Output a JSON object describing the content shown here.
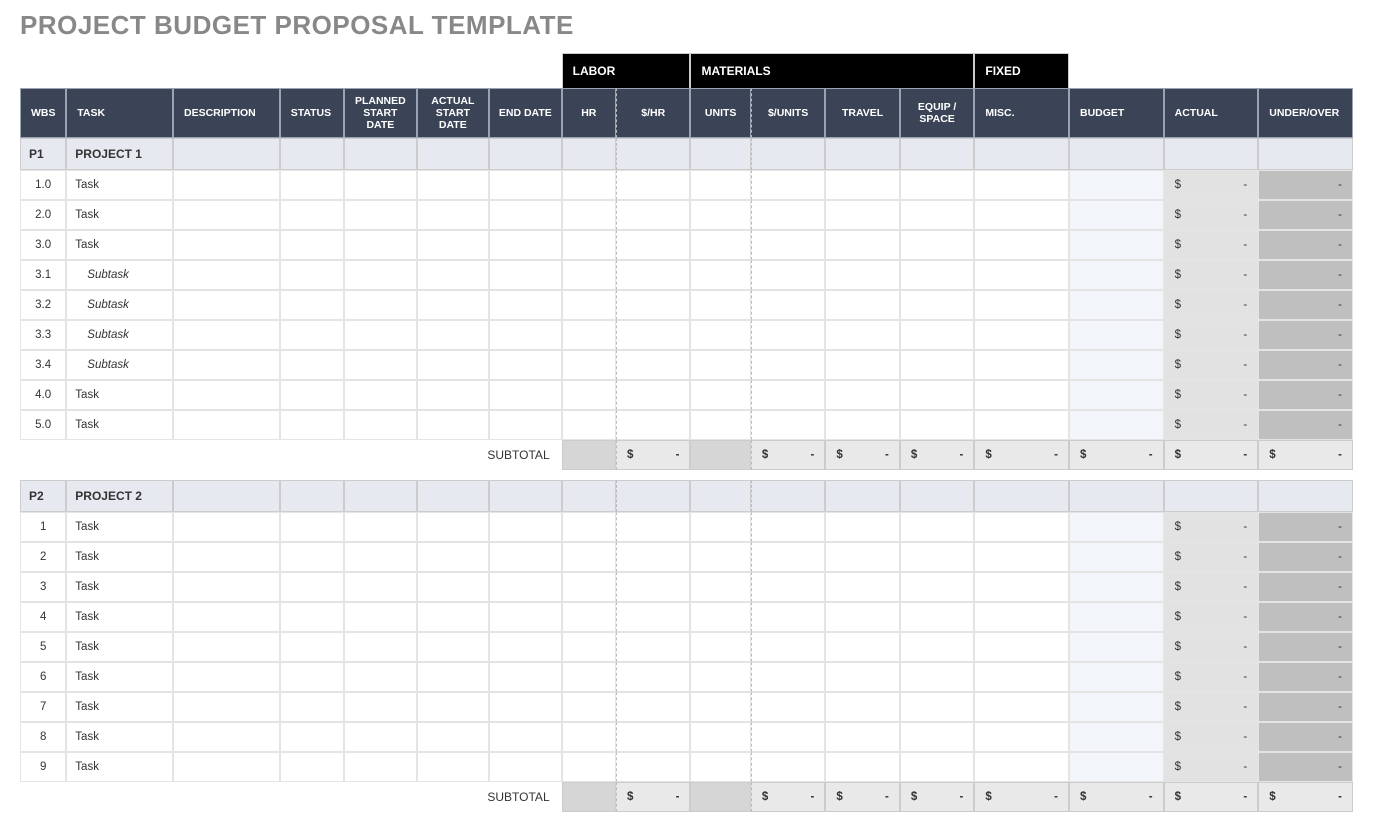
{
  "title": "PROJECT BUDGET PROPOSAL TEMPLATE",
  "groups": {
    "labor": "LABOR",
    "materials": "MATERIALS",
    "fixed": "FIXED"
  },
  "headers": {
    "wbs": "WBS",
    "task": "TASK",
    "desc": "DESCRIPTION",
    "status": "STATUS",
    "planned": "PLANNED START DATE",
    "actual_start": "ACTUAL START DATE",
    "end": "END DATE",
    "hr": "HR",
    "dhr": "$/HR",
    "units": "UNITS",
    "dunits": "$/UNITS",
    "travel": "TRAVEL",
    "equip": "EQUIP / SPACE",
    "misc": "MISC.",
    "budget": "BUDGET",
    "actual": "ACTUAL",
    "uo": "UNDER/OVER"
  },
  "subtotal_label": "SUBTOTAL",
  "money": {
    "sym": "$",
    "dash": "-"
  },
  "projects": [
    {
      "pid": "P1",
      "pname": "PROJECT 1",
      "rows": [
        {
          "wbs": "1.0",
          "task": "Task",
          "sub": false
        },
        {
          "wbs": "2.0",
          "task": "Task",
          "sub": false
        },
        {
          "wbs": "3.0",
          "task": "Task",
          "sub": false
        },
        {
          "wbs": "3.1",
          "task": "Subtask",
          "sub": true
        },
        {
          "wbs": "3.2",
          "task": "Subtask",
          "sub": true
        },
        {
          "wbs": "3.3",
          "task": "Subtask",
          "sub": true
        },
        {
          "wbs": "3.4",
          "task": "Subtask",
          "sub": true
        },
        {
          "wbs": "4.0",
          "task": "Task",
          "sub": false
        },
        {
          "wbs": "5.0",
          "task": "Task",
          "sub": false
        }
      ]
    },
    {
      "pid": "P2",
      "pname": "PROJECT 2",
      "rows": [
        {
          "wbs": "1",
          "task": "Task",
          "sub": false
        },
        {
          "wbs": "2",
          "task": "Task",
          "sub": false
        },
        {
          "wbs": "3",
          "task": "Task",
          "sub": false
        },
        {
          "wbs": "4",
          "task": "Task",
          "sub": false
        },
        {
          "wbs": "5",
          "task": "Task",
          "sub": false
        },
        {
          "wbs": "6",
          "task": "Task",
          "sub": false
        },
        {
          "wbs": "7",
          "task": "Task",
          "sub": false
        },
        {
          "wbs": "8",
          "task": "Task",
          "sub": false
        },
        {
          "wbs": "9",
          "task": "Task",
          "sub": false
        }
      ]
    }
  ]
}
